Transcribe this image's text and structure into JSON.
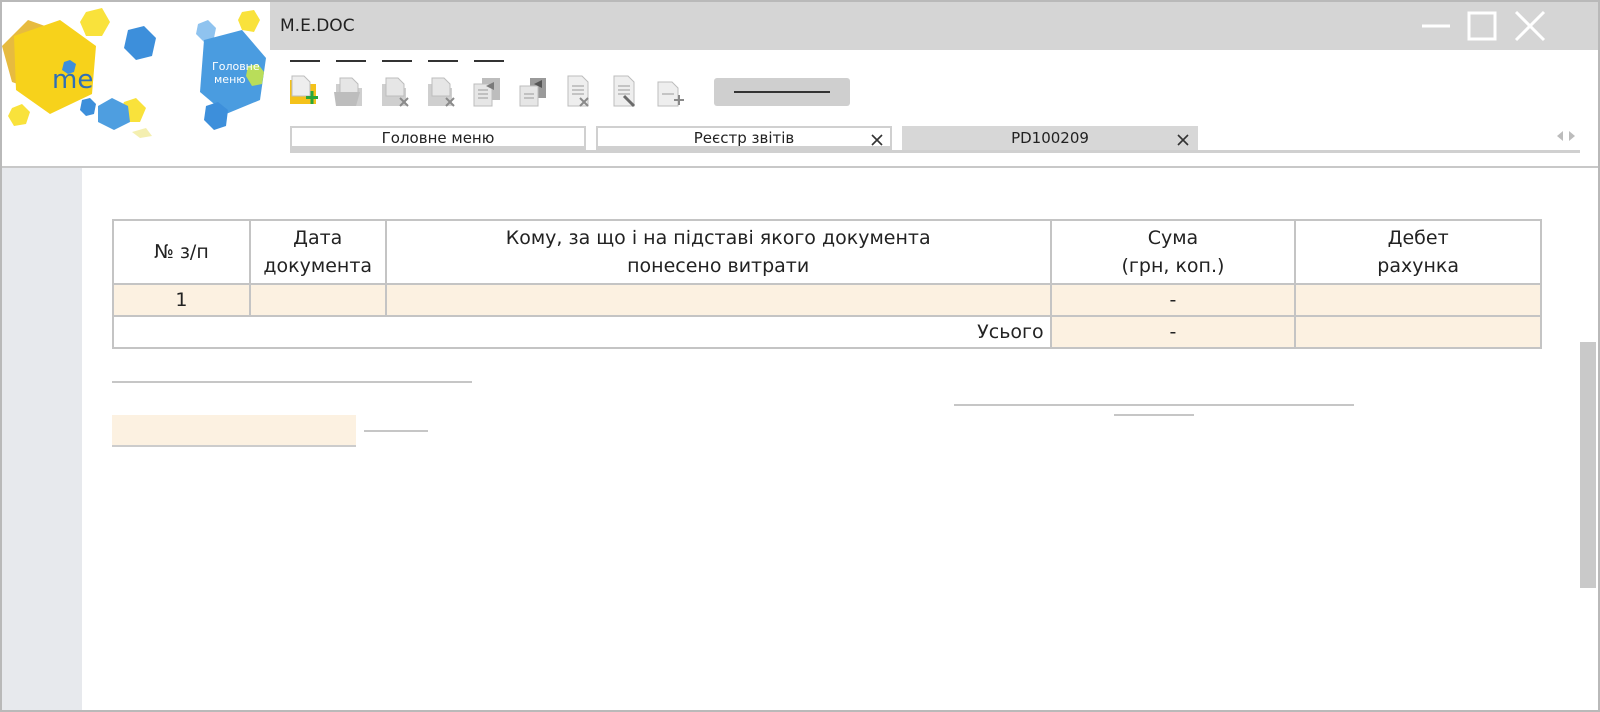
{
  "app": {
    "title": "M.E.DOC",
    "logo_text": "me doc",
    "main_menu_badge": "Головне меню"
  },
  "window_controls": {
    "minimize_icon": "minimize-icon",
    "maximize_icon": "maximize-icon",
    "close_icon": "close-icon"
  },
  "toolbar": {
    "icons": [
      "new-document-icon",
      "open-folder-icon",
      "delete-document-icon",
      "delete-folder-icon",
      "copy-document-icon",
      "move-document-icon",
      "remove-row-icon",
      "edit-document-icon",
      "add-row-icon"
    ]
  },
  "tabs": [
    {
      "label": "Головне меню",
      "closable": false,
      "active": false
    },
    {
      "label": "Реєстр звітів",
      "closable": true,
      "active": false
    },
    {
      "label": "PD100209",
      "closable": true,
      "active": true
    }
  ],
  "table": {
    "headers": {
      "num": "№ з/п",
      "date_l1": "Дата",
      "date_l2": "документа",
      "desc_l1": "Кому, за що і на підставі якого документа",
      "desc_l2": "понесено витрати",
      "sum_l1": "Сума",
      "sum_l2": "(грн, коп.)",
      "debit_l1": "Дебет",
      "debit_l2": "рахунка"
    },
    "rows": [
      {
        "num": "1",
        "date": "",
        "desc": "",
        "sum": "-",
        "debit": ""
      }
    ],
    "total": {
      "label": "Усього",
      "sum": "-",
      "debit": ""
    }
  },
  "colors": {
    "titlebar": "#d5d5d5",
    "input_fill": "#fcf1e1",
    "gutter": "#e7e9ed",
    "logo_yellow": "#f7d21b",
    "logo_blue": "#3d8fdb"
  }
}
